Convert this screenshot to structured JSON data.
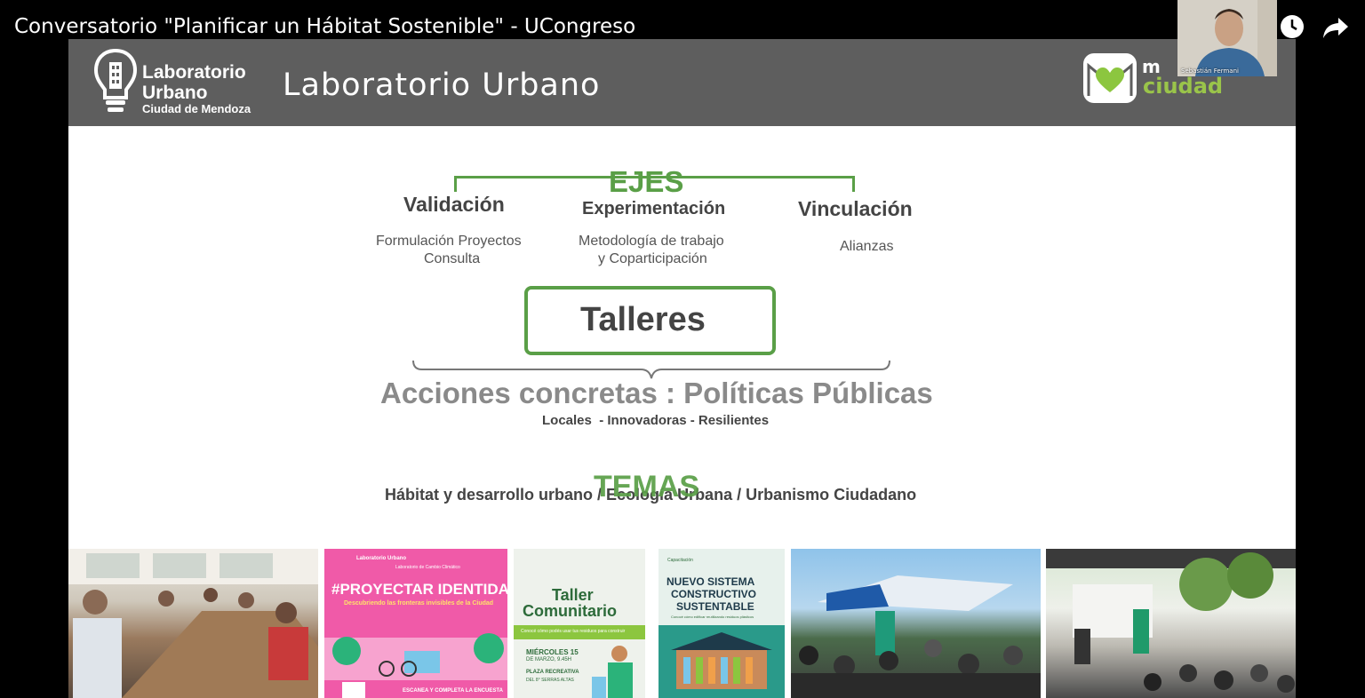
{
  "video": {
    "title": "Conversatorio \"Planificar un Hábitat Sostenible\" - UCongreso"
  },
  "icons": {
    "watch_later": "clock-icon",
    "share": "share-arrow-icon"
  },
  "webcam": {
    "name": "Sebastián Fermani"
  },
  "slide": {
    "logo_left": {
      "line1": "Laboratorio",
      "line2": "Urbano",
      "line3": "Ciudad de Mendoza"
    },
    "header_title": "Laboratorio Urbano",
    "logo_right": {
      "m": "m",
      "ciudad": "ciudad"
    },
    "ejes": {
      "title": "EJES",
      "items": [
        {
          "title": "Validación",
          "sub1": "Formulación Proyectos",
          "sub2": "Consulta"
        },
        {
          "title": "Experimentación",
          "sub1": "Metodología de trabajo",
          "sub2": "y Coparticipación"
        },
        {
          "title": "Vinculación",
          "sub1": "Alianzas",
          "sub2": ""
        }
      ]
    },
    "talleres": "Talleres",
    "acciones": {
      "title": "Acciones concretas : Políticas Públicas",
      "subtitle": "Locales  - Innovadoras - Resilientes"
    },
    "temas": {
      "title": "TEMAS",
      "list": "Hábitat y desarrollo urbano / Ecología Urbana / Urbanismo Ciudadano"
    },
    "posters": {
      "proyectar": {
        "brand": "Laboratorio Urbano",
        "brand2": "Laboratorio de Cambio Climático",
        "title": "#PROYECTAR IDENTIDAD",
        "subtitle": "Descubriendo las fronteras invisibles de la Ciudad",
        "cta": "ESCANEA Y COMPLETA LA ENCUESTA"
      },
      "taller": {
        "title1": "Taller",
        "title2": "Comunitario",
        "banner": "Conocé cómo podés usar tus residuos para construir",
        "date1": "MIÉRCOLES 15",
        "date2": "DE MARZO, 9.45H",
        "place1": "PLAZA RECREATIVA",
        "place2": "DEL 8° SERRAS ALTAS"
      },
      "sistema": {
        "pre": "Capacitación",
        "line1": "NUEVO SISTEMA",
        "line2": "CONSTRUCTIVO",
        "line3": "SUSTENTABLE",
        "sub": "Conocé cómo edificar reutilizando residuos plásticos"
      }
    }
  }
}
